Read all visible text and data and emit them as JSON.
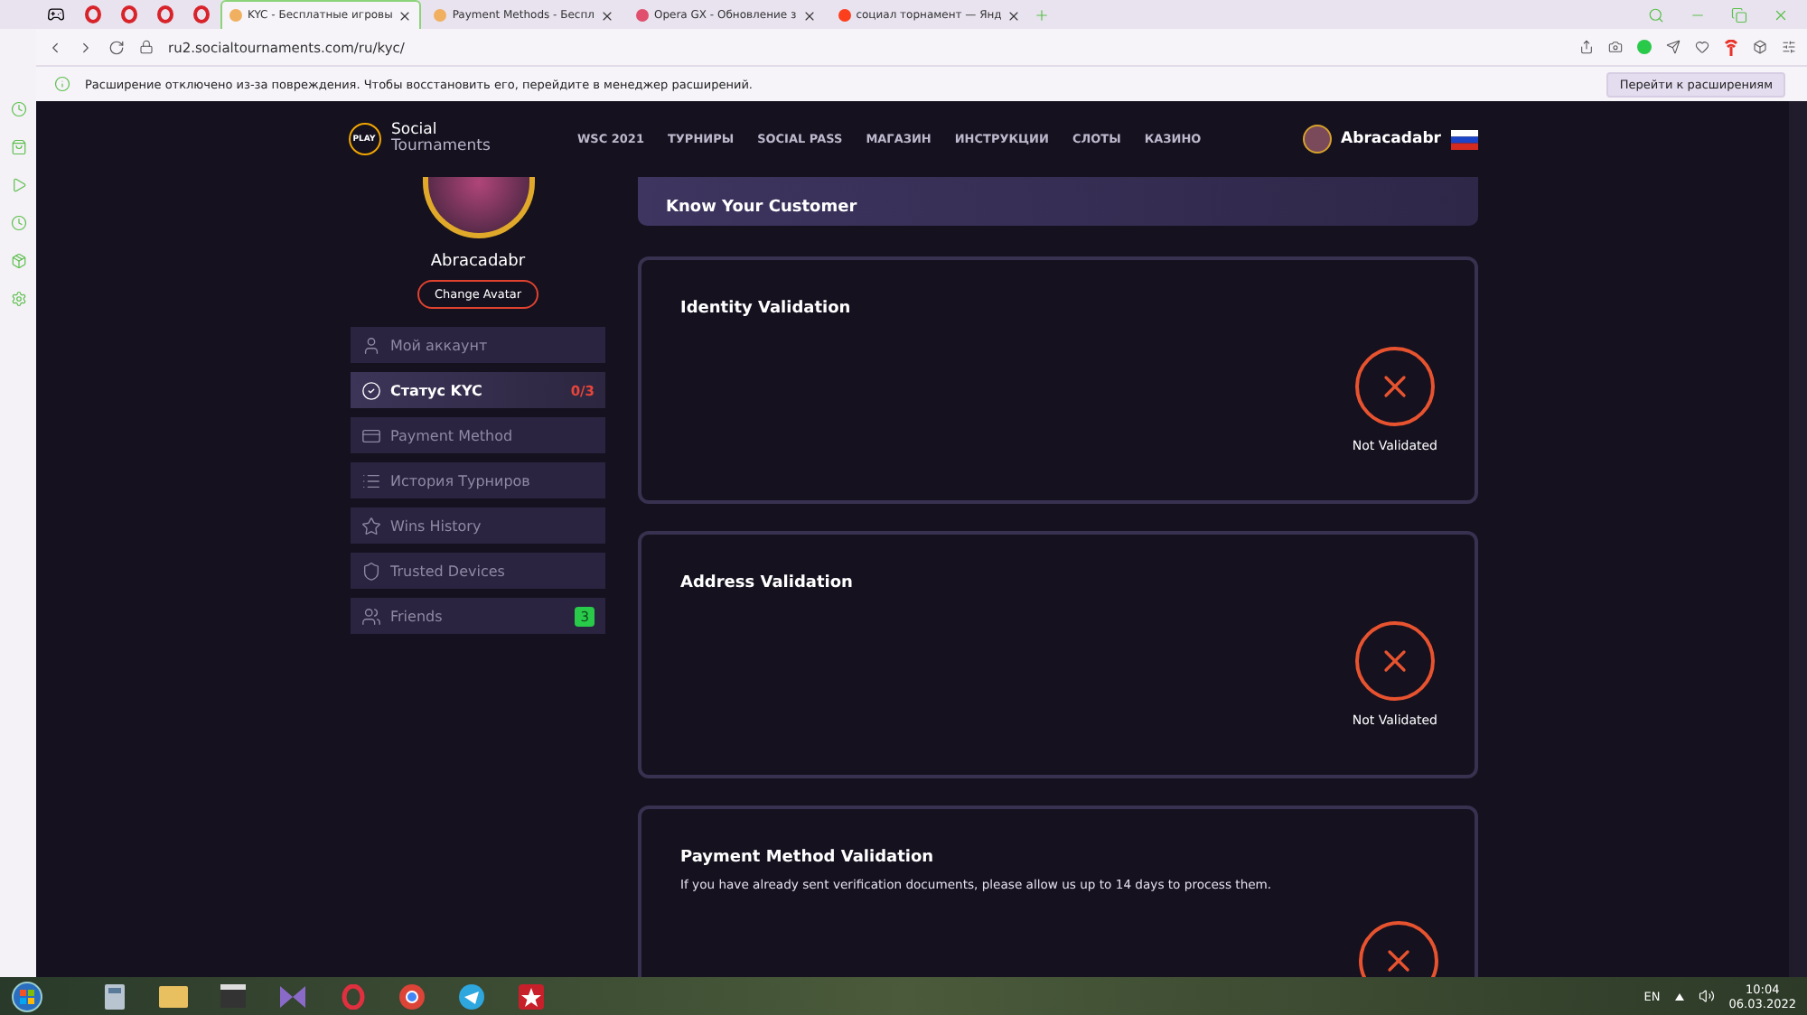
{
  "browser": {
    "tabs": [
      {
        "title": "KYC - Бесплатные игровы",
        "selected": true
      },
      {
        "title": "Payment Methods - Беспл",
        "selected": false
      },
      {
        "title": "Opera GX - Обновление з",
        "selected": false
      },
      {
        "title": "социал торнамент — Янд",
        "selected": false
      }
    ],
    "url": "ru2.socialtournaments.com/ru/kyc/",
    "notice": "Расширение отключено из-за повреждения. Чтобы восстановить его, перейдите в менеджер расширений.",
    "notice_button": "Перейти к расширениям"
  },
  "site": {
    "logo": [
      "Social",
      "Tournaments"
    ],
    "logo_badge": "PLAY",
    "nav": [
      "WSC 2021",
      "ТУРНИРЫ",
      "SOCIAL PASS",
      "МАГАЗИН",
      "ИНСТРУКЦИИ",
      "СЛОТЫ",
      "КАЗИНО"
    ],
    "user": "Abracadabr"
  },
  "profile": {
    "name": "Abracadabr",
    "change_avatar": "Change Avatar",
    "menu": [
      {
        "kind": "account",
        "label": "Мой аккаунт",
        "selected": false
      },
      {
        "kind": "kyc",
        "label": "Статус KYC",
        "selected": true,
        "badge": {
          "text": "0/3",
          "filled": false,
          "color": "#e8453a"
        }
      },
      {
        "kind": "payment",
        "label": "Payment Method",
        "selected": false
      },
      {
        "kind": "history",
        "label": "История Турниров",
        "selected": false
      },
      {
        "kind": "wins",
        "label": "Wins History",
        "selected": false
      },
      {
        "kind": "devices",
        "label": "Trusted Devices",
        "selected": false
      },
      {
        "kind": "friends",
        "label": "Friends",
        "selected": false,
        "badge": {
          "text": "3",
          "filled": true,
          "color": "#29c94a"
        }
      }
    ]
  },
  "kyc": {
    "title": "Know Your Customer",
    "cards": [
      {
        "title": "Identity Validation",
        "status": "Not Validated",
        "validated": false
      },
      {
        "title": "Address Validation",
        "status": "Not Validated",
        "validated": false
      },
      {
        "title": "Payment Method Validation",
        "description": "If you have already sent verification documents, please allow us up to 14 days to process them.",
        "validated": false
      }
    ]
  },
  "taskbar": {
    "language": "EN",
    "time": "10:04",
    "date": "06.03.2022"
  }
}
